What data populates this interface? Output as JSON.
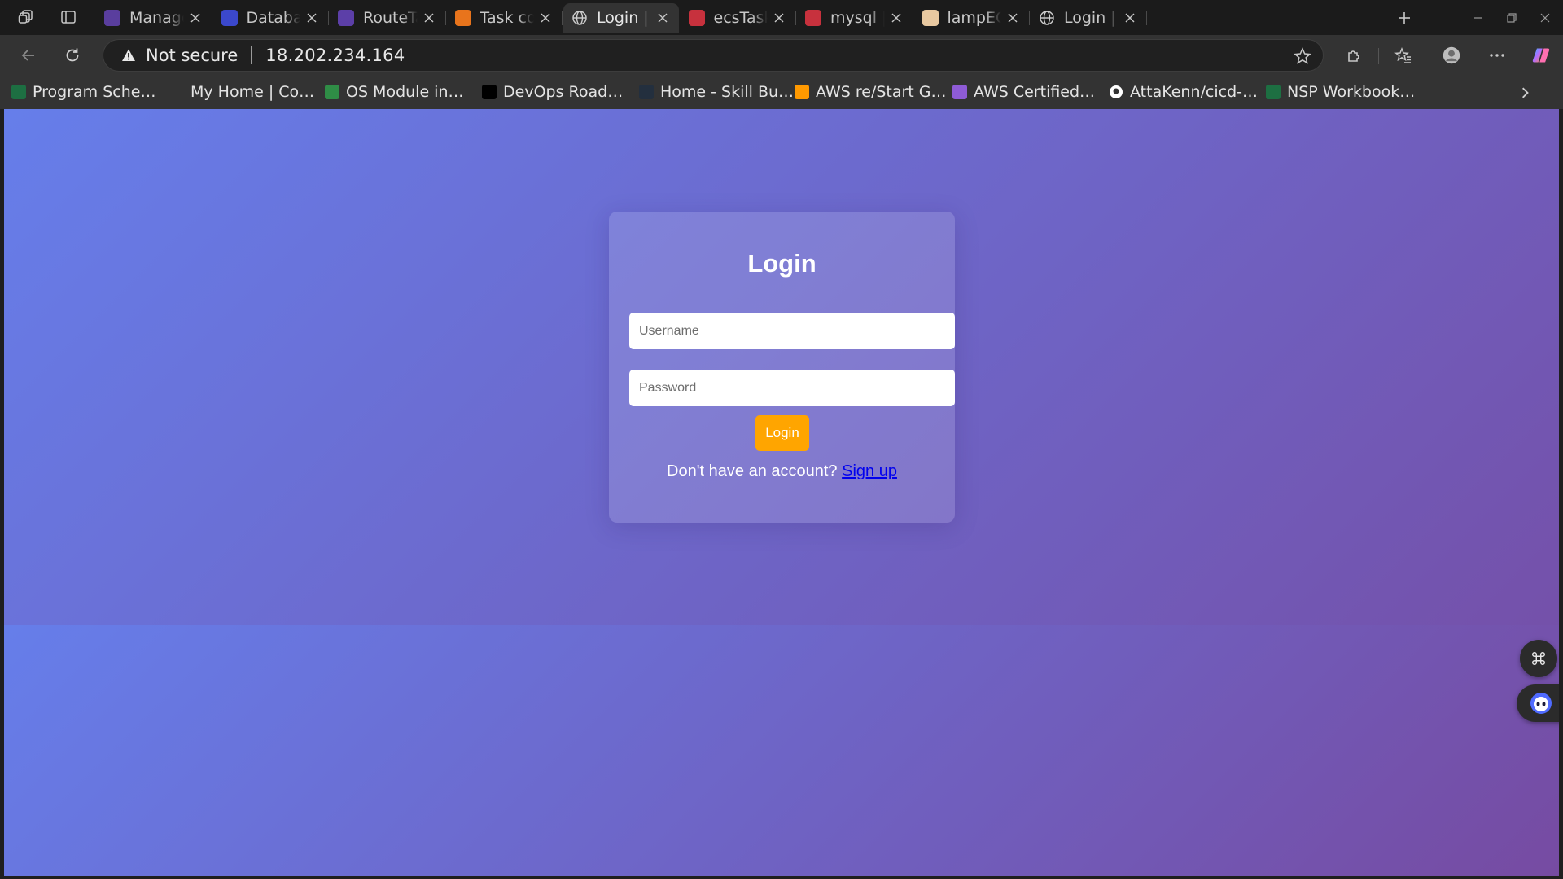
{
  "browser": {
    "tabs": [
      {
        "title": "Manage AWS",
        "favicon": "aws-cube-icon",
        "color": "#5a3e9e",
        "active": false
      },
      {
        "title": "Database De",
        "favicon": "rds-icon",
        "color": "#3b48cc",
        "active": false
      },
      {
        "title": "RouteTable",
        "favicon": "vpc-icon",
        "color": "#5c3fa8",
        "active": false
      },
      {
        "title": "Task config",
        "favicon": "ecs-icon",
        "color": "#e8741c",
        "active": false
      },
      {
        "title": "Login | PHP",
        "favicon": "globe-icon",
        "color": "#cfcfcf",
        "active": true
      },
      {
        "title": "ecsTaskExec",
        "favicon": "iam-icon",
        "color": "#c7313d",
        "active": false
      },
      {
        "title": "mysql | Secr",
        "favicon": "secrets-manager-icon",
        "color": "#c7313d",
        "active": false
      },
      {
        "title": "lampECSder",
        "favicon": "jenkins-icon",
        "color": "#e8c8a0",
        "active": false
      },
      {
        "title": "Login | PHP",
        "favicon": "globe-icon",
        "color": "#cfcfcf",
        "active": false
      }
    ],
    "security_label": "Not secure",
    "url": "18.202.234.164",
    "bookmarks": [
      {
        "label": "Program Sche…",
        "icon": "excel-icon",
        "color": "#1d6f42"
      },
      {
        "label": "My Home | Co…",
        "icon": "home-icon",
        "color": "#2a2a2a"
      },
      {
        "label": "OS Module in…",
        "icon": "geeksforgeeks-icon",
        "color": "#2f8d46"
      },
      {
        "label": "DevOps Road…",
        "icon": "roadmap-icon",
        "color": "#000000"
      },
      {
        "label": "Home - Skill Bu…",
        "icon": "aws-icon",
        "color": "#232f3e"
      },
      {
        "label": "AWS re/Start G…",
        "icon": "amazon-icon",
        "color": "#ff9900"
      },
      {
        "label": "AWS Certified…",
        "icon": "cube-icon",
        "color": "#8e5bd6"
      },
      {
        "label": "AttaKenn/cicd-…",
        "icon": "github-icon",
        "color": "#ffffff"
      },
      {
        "label": "NSP Workbook…",
        "icon": "excel-icon",
        "color": "#1d6f42"
      }
    ]
  },
  "page": {
    "title": "Login",
    "username_placeholder": "Username",
    "password_placeholder": "Password",
    "login_button": "Login",
    "signup_prompt": "Don't have an account?",
    "signup_link": "Sign up",
    "colors": {
      "gradient_start": "#667eea",
      "gradient_end": "#764ba2",
      "button": "#ffa500",
      "link": "#0000ee"
    }
  }
}
